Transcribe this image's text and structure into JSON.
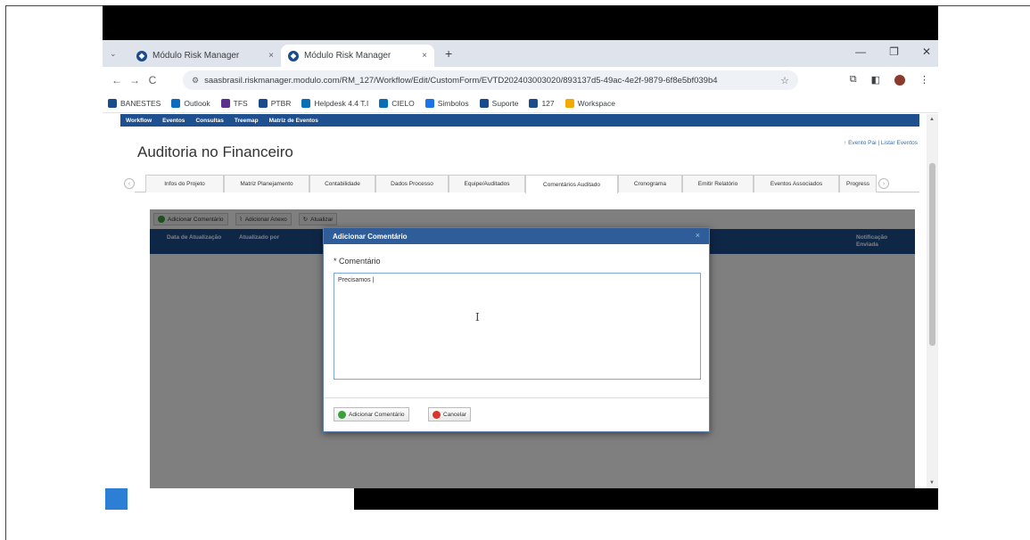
{
  "tabs": [
    {
      "title": "Módulo Risk Manager",
      "close": "×"
    },
    {
      "title": "Módulo Risk Manager",
      "close": "×"
    }
  ],
  "tab_list_glyph": "⌄",
  "new_tab_glyph": "+",
  "window_controls": {
    "minimize": "—",
    "maximize": "❐",
    "close": "✕"
  },
  "nav": {
    "back": "←",
    "forward": "→",
    "reload": "C"
  },
  "url": "saasbrasil.riskmanager.modulo.com/RM_127/Workflow/Edit/CustomForm/EVTD202403003020/893137d5-49ac-4e2f-9879-6f8e5bf039b4",
  "bookmarks": [
    {
      "label": "BANESTES",
      "color": "#1a4b8c"
    },
    {
      "label": "Outlook",
      "color": "#0f6cbd"
    },
    {
      "label": "TFS",
      "color": "#5b2d8e"
    },
    {
      "label": "PTBR",
      "color": "#1a4b8c"
    },
    {
      "label": "Helpdesk 4.4 T.I",
      "color": "#0a6fb5"
    },
    {
      "label": "CIELO",
      "color": "#0a6fb5"
    },
    {
      "label": "Simbolos",
      "color": "#1a73e8"
    },
    {
      "label": "Suporte",
      "color": "#1a4b8c"
    },
    {
      "label": "127",
      "color": "#1a4b8c"
    },
    {
      "label": "Workspace",
      "color": "#f2a900"
    }
  ],
  "app_menu": [
    "Workflow",
    "Eventos",
    "Consultas",
    "Treemap",
    "Matriz de Eventos"
  ],
  "page": {
    "title": "Auditoria no Financeiro",
    "parent_links": "↑ Evento Pai | Listar Eventos"
  },
  "page_tabs": [
    "Infos do Projeto",
    "Matriz Planejamento",
    "Contabilidade",
    "Dados Processo",
    "Equipe/Auditados",
    "Comentários Auditado",
    "Cronograma",
    "Emitir Relatório",
    "Eventos Associados",
    "Progress"
  ],
  "active_tab": "Comentários Auditado",
  "toolbar": {
    "add_comment": "Adicionar Comentário",
    "add_attachment": "Adicionar Anexo",
    "update": "Atualizar"
  },
  "grid_headers": {
    "date": "Data de Atualização",
    "updated_by": "Atualizado por",
    "notification": "Notificação Enviada"
  },
  "modal": {
    "title": "Adicionar Comentário",
    "close": "×",
    "label": "* Comentário",
    "textarea_value": "Precisamos |",
    "add_button": "Adicionar Comentário",
    "cancel_button": "Cancelar"
  },
  "colors": {
    "app_blue": "#1e4f8f",
    "modal_header": "#2f5d9a",
    "add_icon": "#3aa03a",
    "cancel_icon": "#d9362b"
  }
}
